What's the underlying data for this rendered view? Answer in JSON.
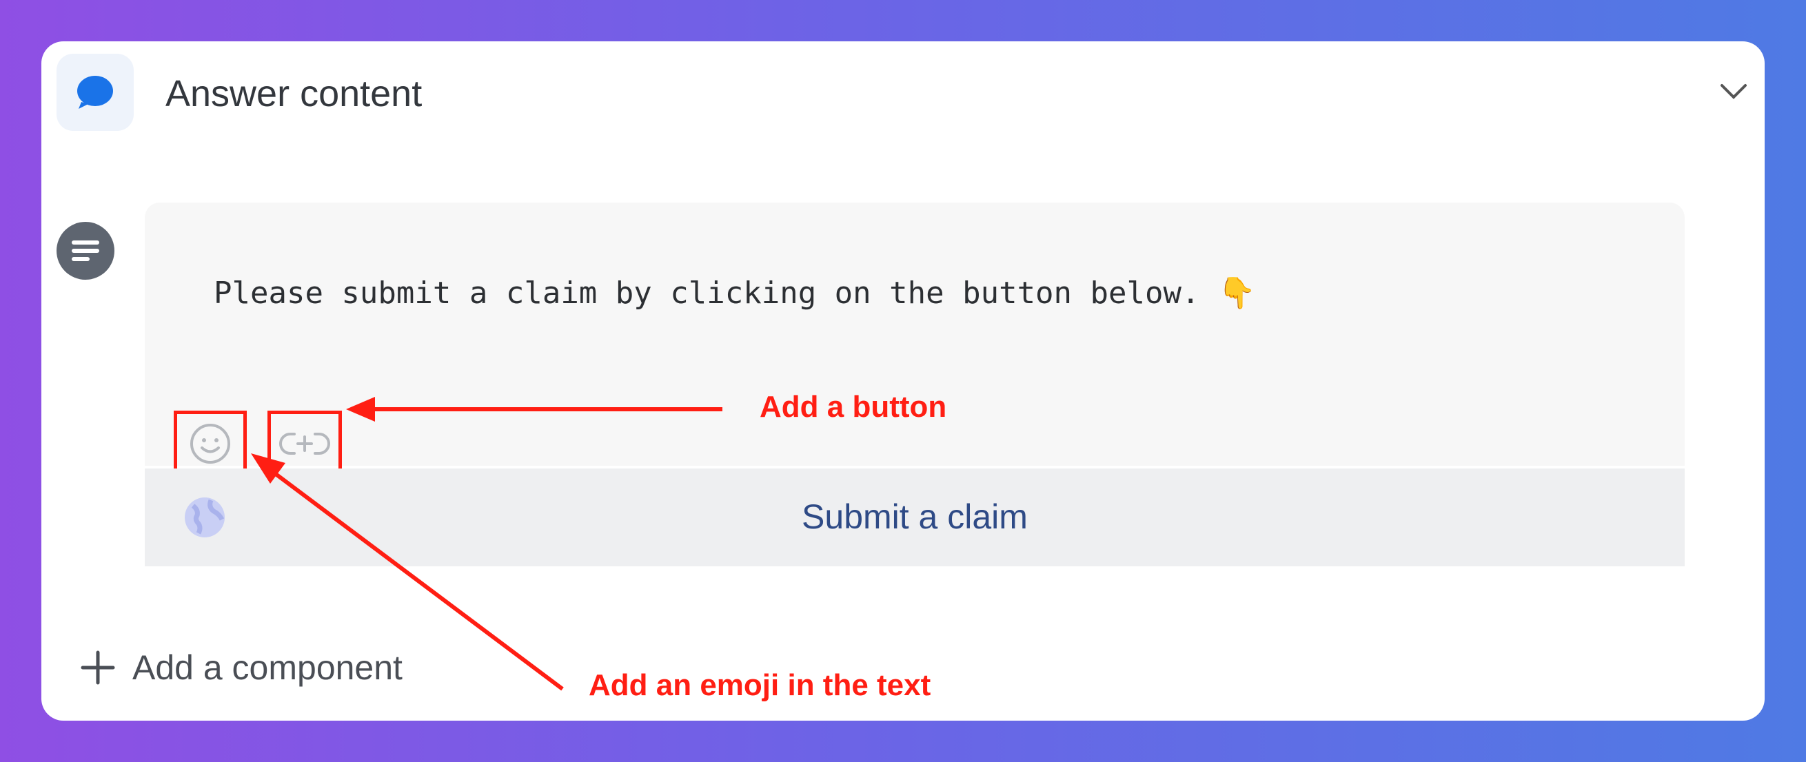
{
  "header": {
    "title": "Answer content",
    "icon": "chat-bubble-icon",
    "toggle_icon": "chevron-down-icon"
  },
  "message_block": {
    "avatar_icon": "text-lines-icon",
    "text": "Please submit a claim by clicking on the button below. 👇"
  },
  "toolbar": {
    "emoji_icon": "smiley-icon",
    "button_icon": "add-link-icon"
  },
  "cta": {
    "label": "Submit a claim",
    "icon": "globe-icon"
  },
  "footer": {
    "add_component_label": "Add a component"
  },
  "annotations": {
    "add_button": "Add a button",
    "add_emoji": "Add an emoji in the text"
  },
  "colors": {
    "accent": "#1a73e8",
    "annotation": "#ff1e13",
    "cta_text": "#2e4a86"
  }
}
